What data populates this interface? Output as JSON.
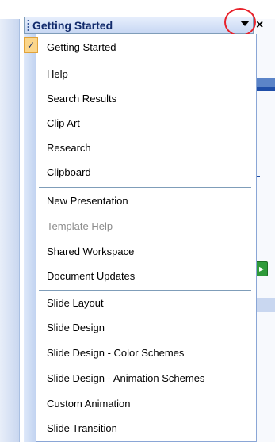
{
  "title": "Getting Started",
  "menu": {
    "items": [
      {
        "label": "Getting Started",
        "checked": true,
        "enabled": true
      },
      {
        "label": "Help",
        "enabled": true
      },
      {
        "label": "Search Results",
        "enabled": true
      },
      {
        "label": "Clip Art",
        "enabled": true
      },
      {
        "label": "Research",
        "enabled": true
      },
      {
        "label": "Clipboard",
        "enabled": true
      },
      {
        "label": "New Presentation",
        "enabled": true
      },
      {
        "label": "Template Help",
        "enabled": false
      },
      {
        "label": "Shared Workspace",
        "enabled": true
      },
      {
        "label": "Document Updates",
        "enabled": true
      },
      {
        "label": "Slide Layout",
        "enabled": true
      },
      {
        "label": "Slide Design",
        "enabled": true
      },
      {
        "label": "Slide Design - Color Schemes",
        "enabled": true
      },
      {
        "label": "Slide Design - Animation Schemes",
        "enabled": true
      },
      {
        "label": "Custom Animation",
        "enabled": true
      },
      {
        "label": "Slide Transition",
        "enabled": true
      }
    ]
  },
  "icons": {
    "checkmark": "checkmark-icon",
    "dropdown": "dropdown-arrow-icon",
    "close": "close-icon",
    "grip": "grip-icon"
  },
  "colors": {
    "highlight_circle": "#e8222b",
    "title_text": "#112a6b",
    "disabled_text": "#8c8c8c"
  }
}
